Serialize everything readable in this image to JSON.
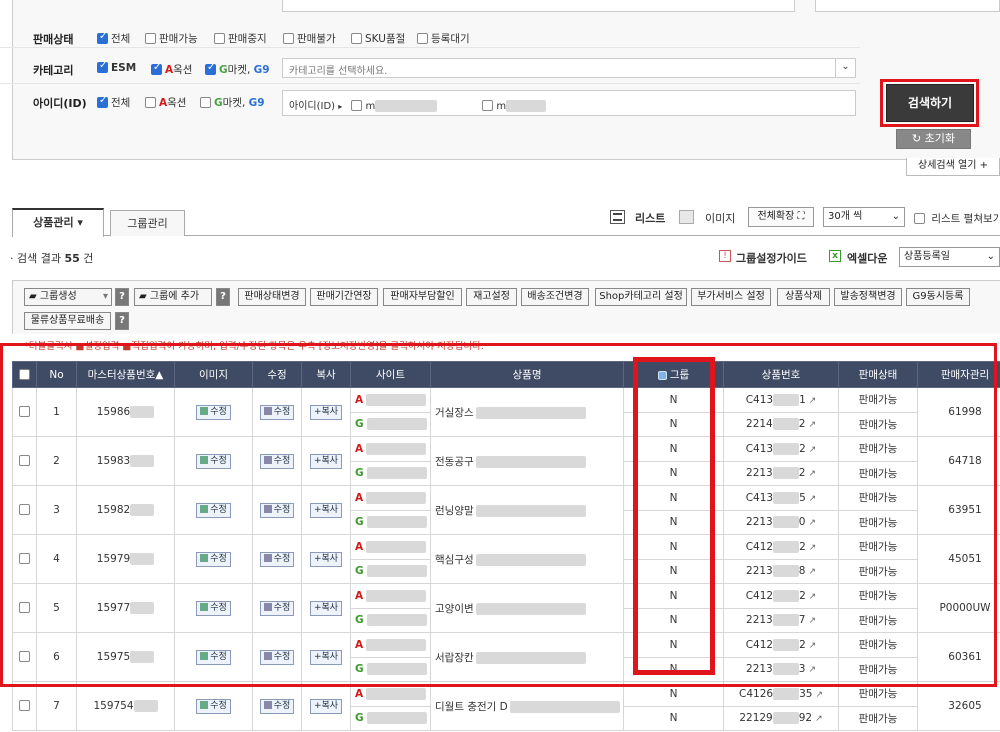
{
  "filters": {
    "sales_status": {
      "label": "판매상태",
      "options": [
        {
          "label": "전체",
          "checked": true
        },
        {
          "label": "판매가능",
          "checked": false
        },
        {
          "label": "판매중지",
          "checked": false
        },
        {
          "label": "판매불가",
          "checked": false
        },
        {
          "label": "SKU품절",
          "checked": false
        },
        {
          "label": "등록대기",
          "checked": false
        }
      ]
    },
    "category": {
      "label": "카테고리",
      "esm": "ESM",
      "auction_A": "A",
      "auction_rest": "옥션",
      "gmarket_G": "G",
      "gmarket_rest": "마켓,",
      "g9": "G9",
      "placeholder": "카테고리를 선택하세요."
    },
    "user_id": {
      "label": "아이디(ID)",
      "all": "전체",
      "auction_A": "A",
      "auction_rest": "옥션",
      "gmarket_G": "G",
      "gmarket_rest": "마켓,",
      "g9": "G9",
      "id_field_label": "아이디(ID)",
      "id_a_prefix": "m",
      "id_b_prefix": "m"
    },
    "search_button": "검색하기",
    "reset_button": "초기화",
    "detail_toggle": "상세검색 열기 +"
  },
  "tabs": [
    {
      "label": "상품관리 ▾",
      "active": true
    },
    {
      "label": "그룹관리",
      "active": false
    }
  ],
  "view_controls": {
    "list": "리스트",
    "image": "이미지",
    "expand": "전체확장",
    "per_page": "30개 씩",
    "list_spread": "리스트 펼쳐보기"
  },
  "results": {
    "prefix": "검색 결과",
    "count": "55",
    "suffix": "건",
    "group_guide": "그룹설정가이드",
    "excel": "엑셀다운",
    "sort": "상품등록일"
  },
  "toolbar": [
    "판매상태변경",
    "판매기간연장",
    "판매자부담할인",
    "재고설정",
    "배송조건변경",
    "Shop카테고리 설정",
    "부가서비스 설정",
    "상품삭제",
    "발송정책변경",
    "G9동시등록"
  ],
  "toolbar_left": {
    "group_create": "그룹생성",
    "add_to_group": "그룹에 추가",
    "help": "?"
  },
  "toolbar_row2": "물류상품무료배송",
  "hint": "*더블클릭시 ■설정입력 ■직접입력이 가능하며, 입력/수정된 항목은 우측 [정보저장반영]을 클릭하셔야 저장됩니다.",
  "table": {
    "headers": [
      "",
      "No",
      "마스터상품번호▲",
      "이미지",
      "수정",
      "복사",
      "사이트",
      "상품명",
      "그룹",
      "상품번호",
      "판매상태",
      "판매자관리"
    ],
    "edit_label": "수정",
    "copy_label": "복사",
    "site_a": "A",
    "site_g": "G",
    "rows": [
      {
        "no": "1",
        "master": "15986",
        "name": "거실장스",
        "group_a": "N",
        "group_g": "N",
        "pno_a": "C413",
        "pno_a_end": "1",
        "pno_g": "2214",
        "pno_g_end": "2",
        "status_a": "판매가능",
        "status_g": "판매가능",
        "seller": "61998"
      },
      {
        "no": "2",
        "master": "15983",
        "name": "전동공구",
        "group_a": "N",
        "group_g": "N",
        "pno_a": "C413",
        "pno_a_end": "2",
        "pno_g": "2213",
        "pno_g_end": "2",
        "status_a": "판매가능",
        "status_g": "판매가능",
        "seller": "64718"
      },
      {
        "no": "3",
        "master": "15982",
        "name": "런닝양말",
        "group_a": "N",
        "group_g": "N",
        "pno_a": "C413",
        "pno_a_end": "5",
        "pno_g": "2213",
        "pno_g_end": "0",
        "status_a": "판매가능",
        "status_g": "판매가능",
        "seller": "63951"
      },
      {
        "no": "4",
        "master": "15979",
        "name": "핵심구성",
        "group_a": "N",
        "group_g": "N",
        "pno_a": "C412",
        "pno_a_end": "2",
        "pno_g": "2213",
        "pno_g_end": "8",
        "status_a": "판매가능",
        "status_g": "판매가능",
        "seller": "45051"
      },
      {
        "no": "5",
        "master": "15977",
        "name": "고양이변",
        "group_a": "N",
        "group_g": "N",
        "pno_a": "C412",
        "pno_a_end": "2",
        "pno_g": "2213",
        "pno_g_end": "7",
        "status_a": "판매가능",
        "status_g": "판매가능",
        "seller": "P0000UW"
      },
      {
        "no": "6",
        "master": "15975",
        "name": "서랍장칸",
        "group_a": "N",
        "group_g": "N",
        "pno_a": "C412",
        "pno_a_end": "2",
        "pno_g": "2213",
        "pno_g_end": "3",
        "status_a": "판매가능",
        "status_g": "판매가능",
        "seller": "60361"
      },
      {
        "no": "7",
        "master": "159754",
        "name": "디월트 충전기 D",
        "group_a": "N",
        "group_g": "N",
        "pno_a": "C4126",
        "pno_a_end": "35",
        "pno_g": "22129",
        "pno_g_end": "92",
        "status_a": "판매가능",
        "status_g": "판매가능",
        "seller": "32605"
      }
    ]
  }
}
